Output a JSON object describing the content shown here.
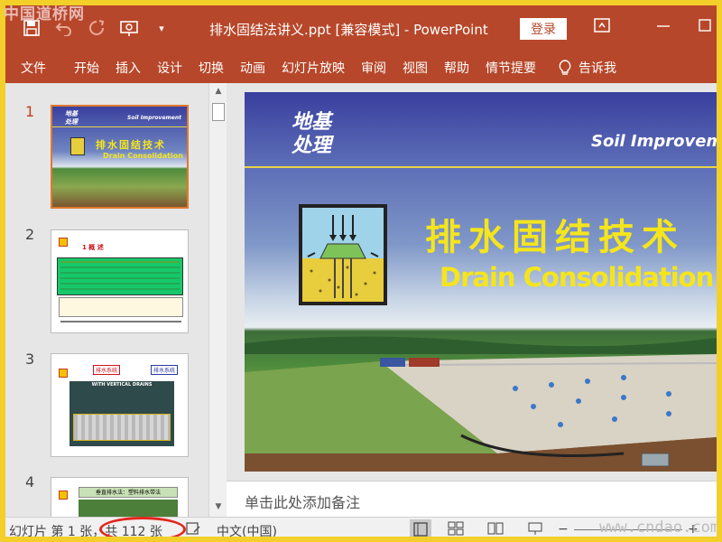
{
  "watermark": {
    "top": "中国道桥网",
    "bottom": "www.cndao.com"
  },
  "titlebar": {
    "title": "排水固结法讲义.ppt [兼容模式] - PowerPoint",
    "login": "登录"
  },
  "ribbon": {
    "tabs": [
      "文件",
      "开始",
      "插入",
      "设计",
      "切换",
      "动画",
      "幻灯片放映",
      "审阅",
      "视图",
      "帮助",
      "情节提要"
    ],
    "tell_me": "告诉我"
  },
  "thumbnails": {
    "items": [
      {
        "number": "1"
      },
      {
        "number": "2"
      },
      {
        "number": "3"
      },
      {
        "number": "4"
      }
    ],
    "slide1": {
      "header_cn": "地基\n处理",
      "header_en": "Soil Improvement",
      "title_cn": "排水固结技术",
      "title_en": "Drain Consolidation"
    },
    "slide2": {
      "heading": "1 概 述"
    },
    "slide3": {
      "label_left": "排水系统",
      "label_right": "排水系统",
      "banner": "WITH VERTICAL DRAINS"
    },
    "slide4": {
      "banner": "垂直排水法：塑料排水带法"
    }
  },
  "slide": {
    "header_cn_line1": "地基",
    "header_cn_line2": "处理",
    "header_en": "Soil Improvement",
    "title_cn": "排水固结技术",
    "title_en": "Drain Consolidation"
  },
  "notes": {
    "placeholder": "单击此处添加备注"
  },
  "status": {
    "slide_pos": "幻灯片 第 1 张，共 112 张",
    "language": "中文(中国)"
  },
  "colors": {
    "accent": "#b7472a",
    "frame": "#f3cf2a",
    "slide_title": "#f5e51c",
    "circle": "#e2261e"
  }
}
